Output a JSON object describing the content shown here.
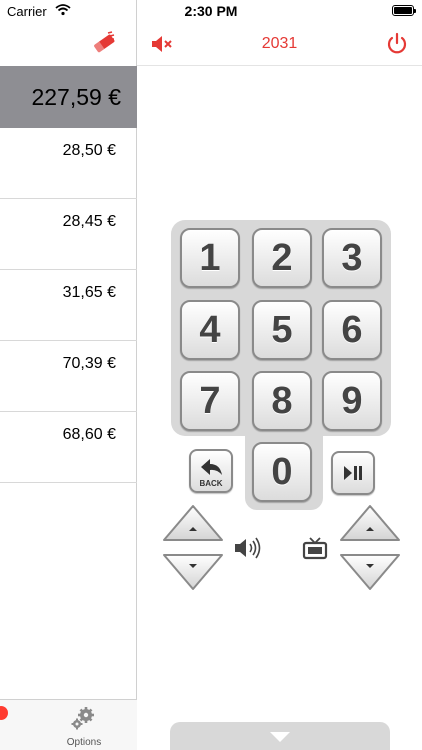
{
  "status_bar": {
    "carrier": "Carrier",
    "time": "2:30 PM"
  },
  "left": {
    "header_icon": "remote-eraser-icon",
    "total": "227,59 €",
    "items": [
      {
        "amount": "28,50 €"
      },
      {
        "amount": "28,45 €"
      },
      {
        "amount": "31,65 €"
      },
      {
        "amount": "70,39 €"
      },
      {
        "amount": "68,60 €"
      }
    ],
    "tabbar": {
      "options_label": "Options",
      "options_icon": "gear-icon"
    }
  },
  "right": {
    "title": "2031",
    "accent_color": "#e53935",
    "mute_icon": "speaker-muted-icon",
    "power_icon": "power-icon"
  },
  "keypad": {
    "keys": [
      "1",
      "2",
      "3",
      "4",
      "5",
      "6",
      "7",
      "8",
      "9",
      "0"
    ],
    "back_label": "BACK",
    "back_icon": "back-arrow-icon",
    "play_pause_icon": "play-pause-icon",
    "volume_icon": "speaker-icon",
    "channel_icon": "tv-icon"
  }
}
